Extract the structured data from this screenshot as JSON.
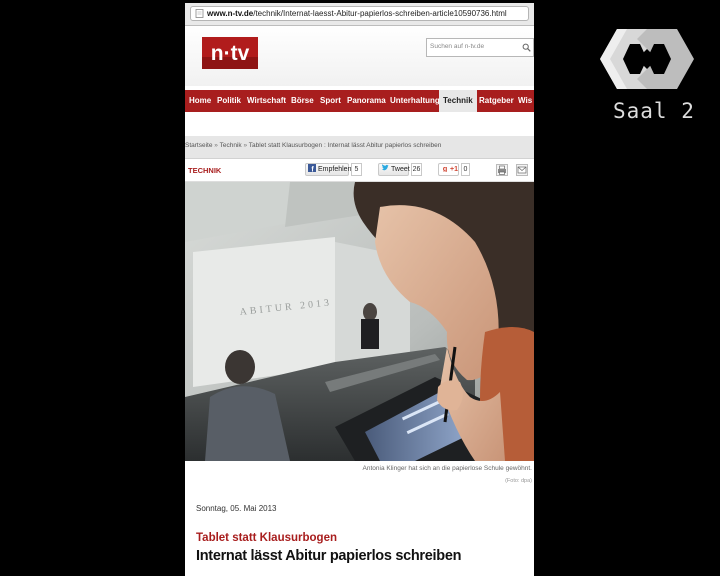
{
  "browser": {
    "url_domain": "www.n-tv.de",
    "url_path": "/technik/Internat-laesst-Abitur-papierlos-schreiben-article10590736.html"
  },
  "header": {
    "logo_text": "n·tv",
    "search_placeholder": "Suchen auf n-tv.de"
  },
  "nav": {
    "items": [
      {
        "label": "Home"
      },
      {
        "label": "Politik"
      },
      {
        "label": "Wirtschaft"
      },
      {
        "label": "Börse"
      },
      {
        "label": "Sport"
      },
      {
        "label": "Panorama"
      },
      {
        "label": "Unterhaltung"
      },
      {
        "label": "Technik"
      },
      {
        "label": "Ratgeber"
      },
      {
        "label": "Wis"
      }
    ],
    "active": "Technik"
  },
  "breadcrumb": {
    "items": [
      "Startseite",
      "Technik",
      "Tablet statt Klausurbogen : Internat lässt Abitur papierlos schreiben"
    ],
    "separator": "»"
  },
  "social": {
    "section": "TECHNIK",
    "facebook_label": "Empfehlen",
    "facebook_count": "5",
    "twitter_label": "Tweet",
    "twitter_count": "26",
    "gplus_label": "+1",
    "gplus_count": "0"
  },
  "article": {
    "image_caption": "Antonia Klinger hat sich an die papierlose Schule gewöhnt.",
    "image_credit": "(Foto: dpa)",
    "image_board_text": "ABITUR 2013",
    "date": "Sonntag, 05. Mai 2013",
    "kicker": "Tablet statt Klausurbogen",
    "headline": "Internat lässt Abitur papierlos schreiben"
  },
  "overlay": {
    "channel_text": "Saal 2"
  },
  "colors": {
    "brand_red": "#a81e1e",
    "background": "#000000"
  }
}
